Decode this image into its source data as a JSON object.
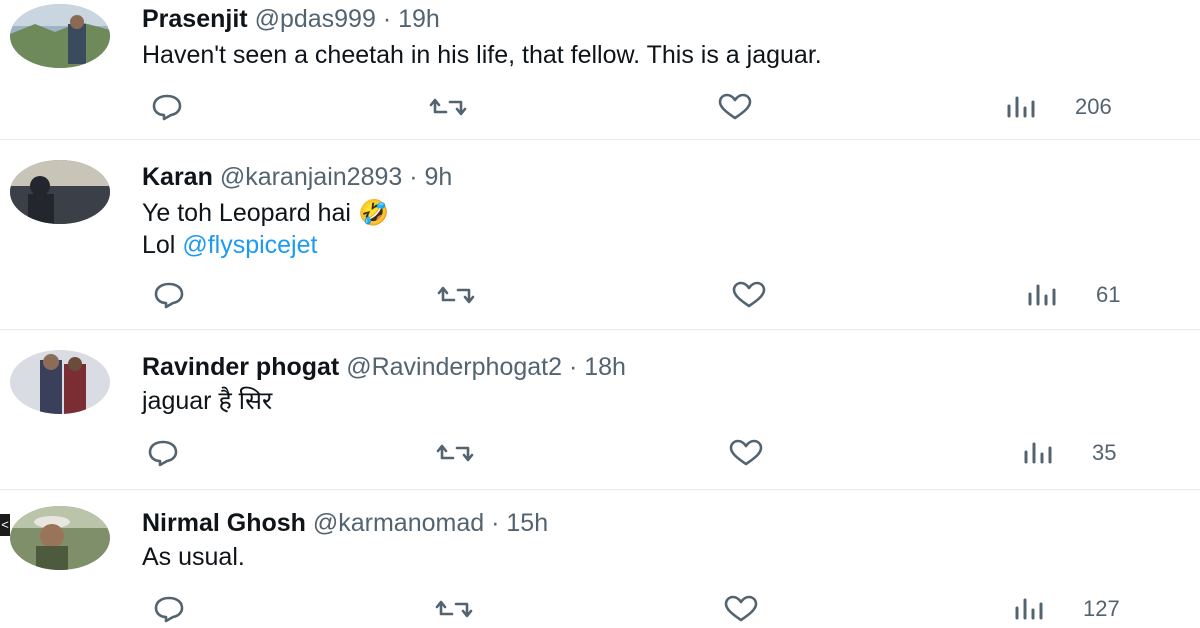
{
  "replies": [
    {
      "name": "Prasenjit",
      "handle": "@pdas999",
      "separator": "·",
      "time": "19h",
      "lines": [
        "Haven't seen a cheetah in his life, that fellow. This is a jaguar."
      ],
      "views": "206"
    },
    {
      "name": "Karan",
      "handle": "@karanjain2893",
      "separator": "·",
      "time": "9h",
      "line1": "Ye toh Leopard hai",
      "emoji": "🤣",
      "line2_prefix": "Lol ",
      "mention": "@flyspicejet",
      "views": "61"
    },
    {
      "name": "Ravinder phogat",
      "handle": "@Ravinderphogat2",
      "separator": "·",
      "time": "18h",
      "lines": [
        "jaguar है सिर"
      ],
      "views": "35"
    },
    {
      "name": "Nirmal Ghosh",
      "handle": "@karmanomad",
      "separator": "·",
      "time": "15h",
      "lines": [
        "As usual."
      ],
      "views": "127"
    }
  ],
  "icons": {
    "reply": "reply-icon",
    "retweet": "retweet-icon",
    "like": "heart-icon",
    "views": "views-icon"
  },
  "edge_arrow": "<",
  "colors": {
    "text": "#0f1419",
    "muted": "#536471",
    "link": "#1d9bf0",
    "divider": "#e6ecf0"
  }
}
